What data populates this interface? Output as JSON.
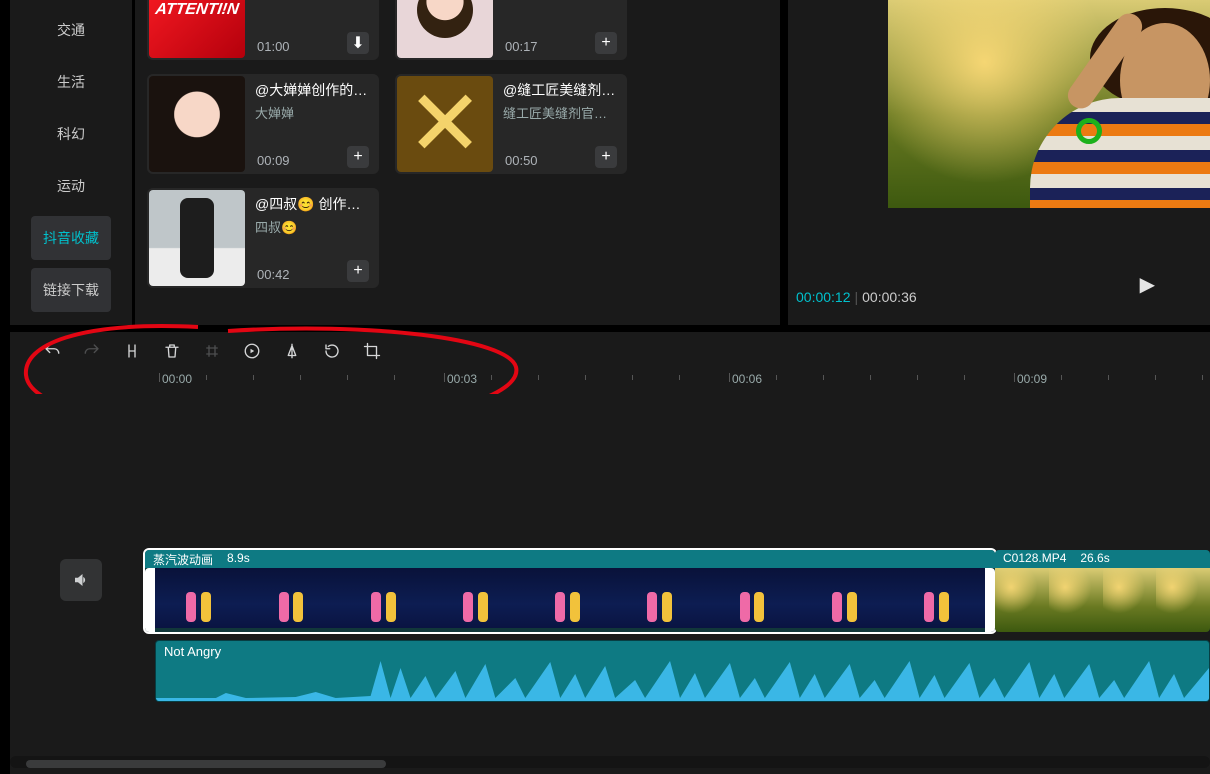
{
  "sidebar": {
    "items": [
      {
        "label": "交通"
      },
      {
        "label": "生活"
      },
      {
        "label": "科幻"
      },
      {
        "label": "运动"
      },
      {
        "label": "抖音收藏"
      },
      {
        "label": "链接下载"
      }
    ]
  },
  "library": [
    {
      "title": "",
      "author": "",
      "duration": "01:00",
      "addGlyph": "⬇"
    },
    {
      "title": "",
      "author": "",
      "duration": "00:17",
      "addGlyph": "+"
    },
    {
      "title": "@大婵婵创作的…",
      "author": "大婵婵",
      "duration": "00:09",
      "addGlyph": "+"
    },
    {
      "title": "@缝工匠美缝剂…",
      "author": "缝工匠美缝剂官…",
      "duration": "00:50",
      "addGlyph": "+"
    },
    {
      "title": "@四叔😊 创作…",
      "author": "四叔😊",
      "duration": "00:42",
      "addGlyph": "+"
    }
  ],
  "preview": {
    "current": "00:00:12",
    "sep": "|",
    "total": "00:00:36",
    "playGlyph": "▶"
  },
  "ruler": [
    "00:00",
    "00:03",
    "00:06",
    "00:09"
  ],
  "clips": {
    "v1": {
      "name": "蒸汽波动画",
      "dur": "8.9s"
    },
    "v2": {
      "name": "C0128.MP4",
      "dur": "26.6s"
    },
    "a1": {
      "name": "Not Angry"
    }
  }
}
